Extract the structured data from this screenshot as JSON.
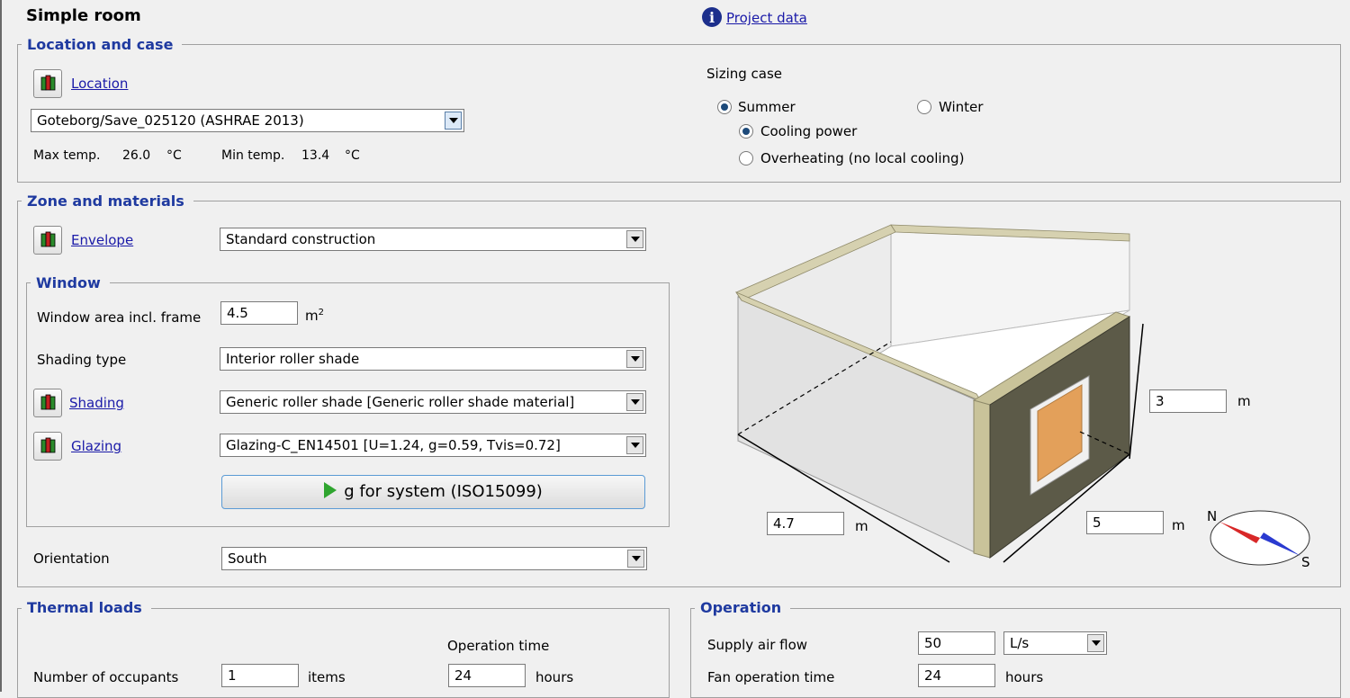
{
  "header": {
    "title": "Simple room",
    "project_link": "Project data"
  },
  "location_case": {
    "legend": "Location and case",
    "location_link": "Location",
    "location_value": "Goteborg/Save_025120 (ASHRAE 2013)",
    "max_temp_label": "Max temp.",
    "max_temp_value": "26.0",
    "min_temp_label": "Min temp.",
    "min_temp_value": "13.4",
    "unit_c": "°C",
    "sizing_case_label": "Sizing case",
    "summer": "Summer",
    "winter": "Winter",
    "cooling_power": "Cooling power",
    "overheating": "Overheating (no local cooling)",
    "selected_season": "Summer",
    "selected_mode": "Cooling power"
  },
  "zone": {
    "legend": "Zone and materials",
    "envelope_link": "Envelope",
    "envelope_value": "Standard construction",
    "orientation_label": "Orientation",
    "orientation_value": "South"
  },
  "window": {
    "legend": "Window",
    "area_label": "Window area incl. frame",
    "area_value": "4.5",
    "area_unit": "m",
    "area_unit_sup": "2",
    "shading_type_label": "Shading type",
    "shading_type_value": "Interior roller shade",
    "shading_link": "Shading",
    "shading_value": "Generic roller shade [Generic roller shade material]",
    "glazing_link": "Glazing",
    "glazing_value": "Glazing-C_EN14501 [U=1.24, g=0.59, Tvis=0.72]",
    "g_button": "g for system (ISO15099)"
  },
  "room_dims": {
    "height_value": "3",
    "width_value": "4.7",
    "depth_value": "5",
    "unit": "m",
    "compass_n": "N",
    "compass_s": "S"
  },
  "thermal": {
    "legend": "Thermal loads",
    "operation_time_label": "Operation time",
    "occupants_label": "Number of occupants",
    "occupants_value": "1",
    "occupants_unit": "items",
    "occupants_time": "24",
    "hours": "hours"
  },
  "operation": {
    "legend": "Operation",
    "supply_air_label": "Supply air flow",
    "supply_air_value": "50",
    "supply_air_unit": "L/s",
    "fan_time_label": "Fan operation time",
    "fan_time_value": "24",
    "hours": "hours"
  },
  "colors": {
    "legend": "#1f3aa0",
    "link": "#1a1aa8",
    "window_pane": "#e3a05a",
    "wall_texture": "#5c5a48",
    "insulation": "#c9c39a"
  }
}
